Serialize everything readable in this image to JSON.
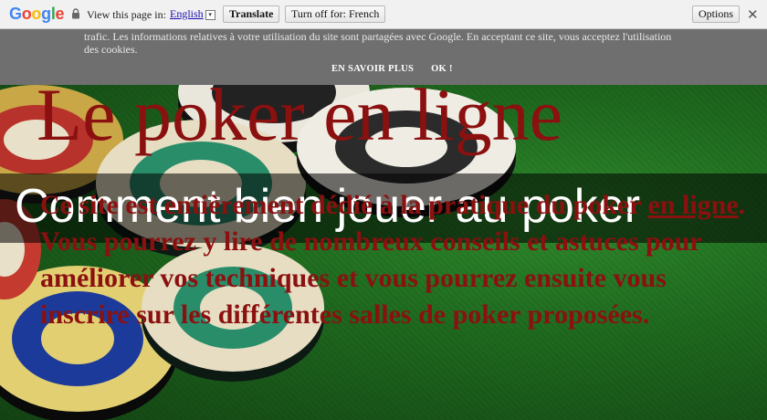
{
  "translate_bar": {
    "logo_letters": [
      "G",
      "o",
      "o",
      "g",
      "l",
      "e"
    ],
    "view_label": "View this page in:",
    "language": "English",
    "language_arrow": "▾",
    "translate_button": "Translate",
    "turn_off_button": "Turn off for: French",
    "options_button": "Options",
    "close": "✕"
  },
  "cookie_banner": {
    "text": "trafic. Les informations relatives à votre utilisation du site sont partagées avec Google. En acceptant ce site, vous acceptez l'utilisation des cookies.",
    "learn_more": "EN SAVOIR PLUS",
    "ok": "OK !"
  },
  "hero": {
    "heading": "Le poker en ligne",
    "banner_title": "Comment bien jouer au poker",
    "intro_before": "Ce site est entièrement dédié à la pratique du poker ",
    "intro_link": "en ligne",
    "intro_after": ". Vous pourrez y lire de nombreux conseils et astuces pour améliorer vos techniques et vous pourrez ensuite vous inscrire sur les différentes salles de poker proposées."
  },
  "colors": {
    "heading_red": "#8b1010",
    "felt_green": "#1f6a1f",
    "google_blue": "#4285f4",
    "google_red": "#ea4335",
    "google_yellow": "#fbbc05",
    "google_green": "#34a853"
  }
}
